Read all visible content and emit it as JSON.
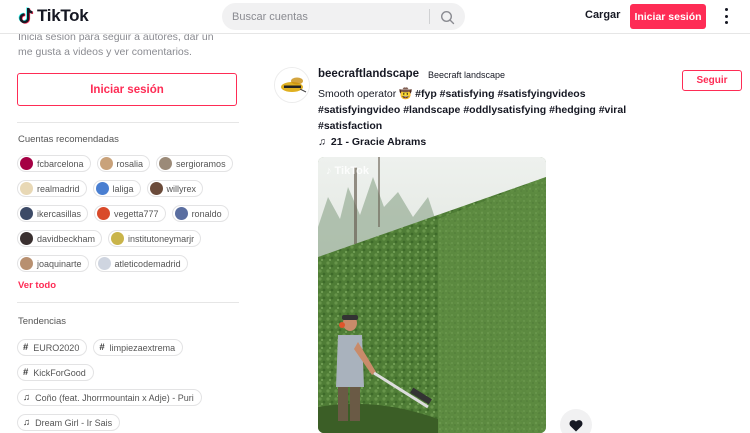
{
  "header": {
    "logo_text": "TikTok",
    "search_placeholder": "Buscar cuentas",
    "upload_label": "Cargar",
    "login_label": "Iniciar sesión",
    "more_icon": "more-vertical-icon"
  },
  "sidebar": {
    "intro_line1": "Inicia sesión para seguir a autores, dar un",
    "intro_line2": "me gusta a videos y ver comentarios.",
    "login_label": "Iniciar sesión",
    "accounts_heading": "Cuentas recomendadas",
    "accounts": [
      {
        "name": "fcbarcelona",
        "color": "#a50044"
      },
      {
        "name": "rosalia",
        "color": "#c9a27a"
      },
      {
        "name": "sergioramos",
        "color": "#9b8a78"
      },
      {
        "name": "realmadrid",
        "color": "#e8d8b5"
      },
      {
        "name": "laliga",
        "color": "#4a7fd1"
      },
      {
        "name": "willyrex",
        "color": "#6b4b3a"
      },
      {
        "name": "ikercasillas",
        "color": "#3c4a66"
      },
      {
        "name": "vegetta777",
        "color": "#d94a2a"
      },
      {
        "name": "ronaldo",
        "color": "#5a6ea0"
      },
      {
        "name": "davidbeckham",
        "color": "#3a3030"
      },
      {
        "name": "institutoneymarjr",
        "color": "#c9b44a"
      },
      {
        "name": "joaquinarte",
        "color": "#b89070"
      },
      {
        "name": "atleticodemadrid",
        "color": "#cfd5e0"
      }
    ],
    "see_all_label": "Ver todo",
    "trends_heading": "Tendencias",
    "trends": [
      {
        "type": "hashtag",
        "label": "EURO2020"
      },
      {
        "type": "hashtag",
        "label": "limpiezaextrema"
      },
      {
        "type": "hashtag",
        "label": "KickForGood"
      },
      {
        "type": "music",
        "label": "Coño (feat. Jhorrmountain x Adje) - Puri"
      },
      {
        "type": "music",
        "label": "Dream Girl - Ir Sais"
      }
    ],
    "hashtag_glyph": "#",
    "music_glyph": "♫"
  },
  "post": {
    "author_username": "beecraftlandscape",
    "author_nickname": "Beecraft landscape",
    "follow_label": "Seguir",
    "caption_text": "Smooth operator",
    "caption_emoji": "🤠",
    "hashtags": [
      "#fyp",
      "#satisfying",
      "#satisfyingvideos",
      "#satisfyingvideo",
      "#landscape",
      "#oddlysatisfying",
      "#hedging",
      "#viral",
      "#satisfaction"
    ],
    "music_glyph": "♫",
    "music_label": "21 - Gracie Abrams",
    "watermark_text": "TikTok",
    "like_icon": "heart-icon"
  },
  "colors": {
    "brand": "#fe2c55",
    "text": "#161823",
    "muted": "#8a8b91"
  }
}
